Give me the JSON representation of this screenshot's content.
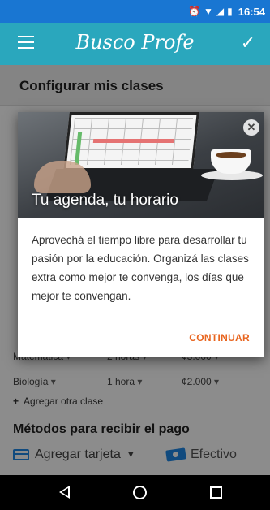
{
  "status_bar": {
    "time": "16:54",
    "icons": [
      "alarm-icon",
      "wifi-icon",
      "signal-icon",
      "battery-icon"
    ]
  },
  "toolbar": {
    "brand": "Busco Profe",
    "menu_icon": "menu-icon",
    "action_icon": "check-icon"
  },
  "subheader": {
    "title": "Configurar mis clases"
  },
  "background": {
    "subjects": [
      {
        "subject": "Matemática",
        "duration": "2 horas",
        "price": "¢3.000"
      },
      {
        "subject": "Biología",
        "duration": "1 hora",
        "price": "¢2.000"
      }
    ],
    "add_class": "Agregar otra clase",
    "payment_title": "Métodos para recibir el pago",
    "payment_card": "Agregar tarjeta",
    "payment_cash": "Efectivo"
  },
  "dialog": {
    "title": "Tu agenda, tu horario",
    "body": "Aprovechá el tiempo libre para desarrollar tu pasión por la educación. Organizá las clases extra como mejor te convenga, los días que mejor te convengan.",
    "action": "CONTINUAR",
    "close_icon": "close-icon"
  },
  "nav_bar": {
    "icons": [
      "back-icon",
      "home-icon",
      "recents-icon"
    ]
  }
}
